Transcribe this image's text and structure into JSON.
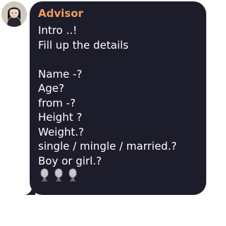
{
  "message": {
    "sender": "Advisor",
    "sender_color": "#f0a05c",
    "bubble_color": "#1c1c2b",
    "lines": [
      "Intro ..!",
      "Fill up the details",
      "",
      "Name -?",
      "Age?",
      "from -?",
      "Height ?",
      "Weight.?",
      "single / mingle / married.?",
      "Boy or girl.?"
    ],
    "emojis": [
      "microphone-emoji",
      "microphone-emoji",
      "microphone-emoji"
    ]
  },
  "avatar": {
    "icon": "anime-character-avatar"
  }
}
